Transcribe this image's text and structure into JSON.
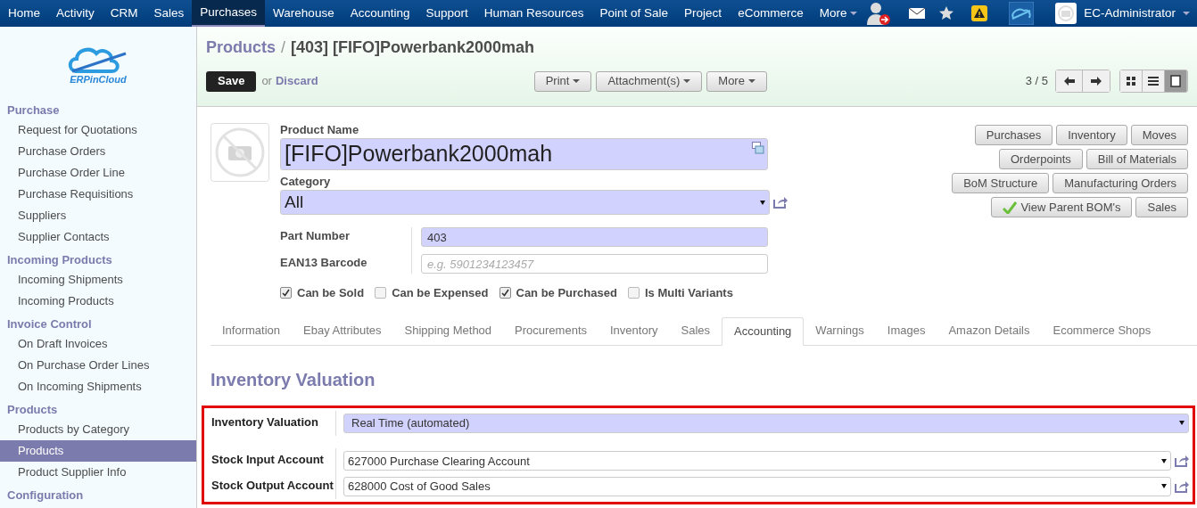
{
  "topnav": {
    "items": [
      {
        "label": "Home",
        "selected": false
      },
      {
        "label": "Activity",
        "selected": false
      },
      {
        "label": "CRM",
        "selected": false
      },
      {
        "label": "Sales",
        "selected": false
      },
      {
        "label": "Purchases",
        "selected": true
      },
      {
        "label": "Warehouse",
        "selected": false
      },
      {
        "label": "Accounting",
        "selected": false
      },
      {
        "label": "Support",
        "selected": false
      },
      {
        "label": "Human Resources",
        "selected": false
      },
      {
        "label": "Point of Sale",
        "selected": false
      },
      {
        "label": "Project",
        "selected": false
      },
      {
        "label": "eCommerce",
        "selected": false
      }
    ],
    "more": "More",
    "user": "EC-Administrator"
  },
  "sidebar": {
    "logo_text": "ERPinCloud",
    "sections": [
      {
        "title": "Purchase",
        "items": [
          {
            "label": "Request for Quotations",
            "selected": false
          },
          {
            "label": "Purchase Orders",
            "selected": false
          },
          {
            "label": "Purchase Order Line",
            "selected": false
          },
          {
            "label": "Purchase Requisitions",
            "selected": false
          },
          {
            "label": "Suppliers",
            "selected": false
          },
          {
            "label": "Supplier Contacts",
            "selected": false
          }
        ]
      },
      {
        "title": "Incoming Products",
        "items": [
          {
            "label": "Incoming Shipments",
            "selected": false
          },
          {
            "label": "Incoming Products",
            "selected": false
          }
        ]
      },
      {
        "title": "Invoice Control",
        "items": [
          {
            "label": "On Draft Invoices",
            "selected": false
          },
          {
            "label": "On Purchase Order Lines",
            "selected": false
          },
          {
            "label": "On Incoming Shipments",
            "selected": false
          }
        ]
      },
      {
        "title": "Products",
        "items": [
          {
            "label": "Products by Category",
            "selected": false
          },
          {
            "label": "Products",
            "selected": true
          },
          {
            "label": "Product Supplier Info",
            "selected": false
          }
        ]
      },
      {
        "title": "Configuration"
      }
    ]
  },
  "header": {
    "breadcrumb": "Products",
    "separator": "/",
    "title": "[403] [FIFO]Powerbank2000mah",
    "save": "Save",
    "or": "or",
    "discard": "Discard",
    "menus": [
      "Print",
      "Attachment(s)",
      "More"
    ],
    "pager": "3 / 5",
    "views": [
      {
        "kind": "kanban",
        "selected": false
      },
      {
        "kind": "list",
        "selected": false
      },
      {
        "kind": "form",
        "selected": true
      }
    ]
  },
  "form": {
    "name_label": "Product Name",
    "name": "[FIFO]Powerbank2000mah",
    "category_label": "Category",
    "category": "All",
    "fields": [
      {
        "label": "Part Number",
        "value": "403"
      },
      {
        "label": "EAN13 Barcode",
        "placeholder": "e.g. 5901234123457"
      }
    ],
    "checkboxes": [
      {
        "label": "Can be Sold",
        "checked": true
      },
      {
        "label": "Can be Expensed",
        "checked": false
      },
      {
        "label": "Can be Purchased",
        "checked": true
      },
      {
        "label": "Is Multi Variants",
        "checked": false
      }
    ],
    "smart_buttons": [
      [
        {
          "label": "Purchases"
        },
        {
          "label": "Inventory"
        },
        {
          "label": "Moves"
        }
      ],
      [
        {
          "label": "Orderpoints"
        },
        {
          "label": "Bill of Materials"
        }
      ],
      [
        {
          "label": "BoM Structure"
        },
        {
          "label": "Manufacturing Orders"
        }
      ],
      [
        {
          "label": "View Parent BOM's",
          "kind": "check"
        },
        {
          "label": "Sales"
        }
      ]
    ]
  },
  "tabs": [
    {
      "label": "Information",
      "selected": false
    },
    {
      "label": "Ebay Attributes",
      "selected": false
    },
    {
      "label": "Shipping Method",
      "selected": false
    },
    {
      "label": "Procurements",
      "selected": false
    },
    {
      "label": "Inventory",
      "selected": false
    },
    {
      "label": "Sales",
      "selected": false
    },
    {
      "label": "Accounting",
      "selected": true
    },
    {
      "label": "Warnings",
      "selected": false
    },
    {
      "label": "Images",
      "selected": false
    },
    {
      "label": "Amazon Details",
      "selected": false
    },
    {
      "label": "Ecommerce Shops",
      "selected": false
    }
  ],
  "section": {
    "title": "Inventory Valuation",
    "fields": [
      {
        "label": "Inventory Valuation",
        "value": "Real Time (automated)",
        "kind": "selection",
        "required": true
      },
      {
        "label": "Stock Input Account",
        "value": "627000 Purchase Clearing Account",
        "kind": "many2one",
        "required": false
      },
      {
        "label": "Stock Output Account",
        "value": "628000 Cost of Good Sales",
        "kind": "many2one",
        "required": false
      }
    ]
  }
}
